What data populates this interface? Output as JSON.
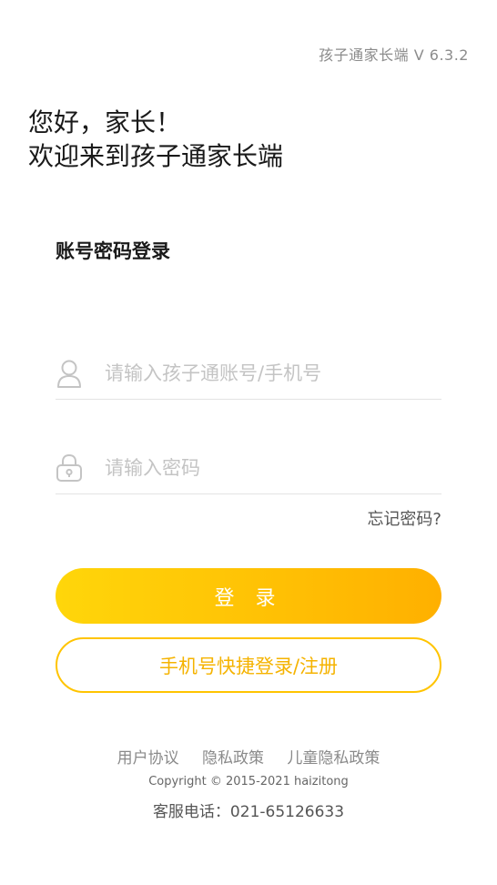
{
  "app": {
    "version_text": "孩子通家长端 V 6.3.2"
  },
  "greeting": {
    "line1": "您好，家长！",
    "line2": "欢迎来到孩子通家长端"
  },
  "login": {
    "title": "账号密码登录",
    "account_placeholder": "请输入孩子通账号/手机号",
    "account_icon": "user-icon",
    "password_placeholder": "请输入密码",
    "password_icon": "lock-icon",
    "forgot_label": "忘记密码?",
    "login_button": "登 录",
    "quick_login_button": "手机号快捷登录/注册"
  },
  "footer": {
    "links": [
      "用户协议",
      "隐私政策",
      "儿童隐私政策"
    ],
    "copyright": "Copyright © 2015-2021 haizitong",
    "service_phone": "客服电话：021-65126633"
  },
  "colors": {
    "accent_start": "#ffd60a",
    "accent_end": "#ffb000",
    "accent_text": "#f5b300"
  }
}
